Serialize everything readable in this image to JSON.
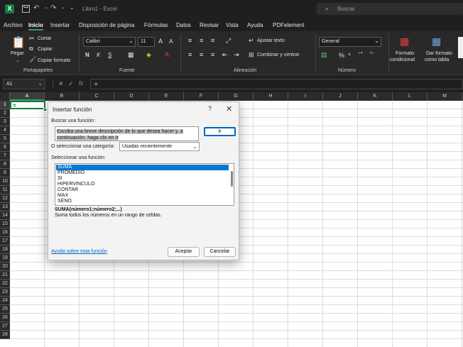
{
  "window": {
    "title": "Libro1 - Excel",
    "search_placeholder": "Buscar"
  },
  "menu": {
    "items": [
      "Archivo",
      "Inicio",
      "Insertar",
      "Disposición de página",
      "Fórmulas",
      "Datos",
      "Revisar",
      "Vista",
      "Ayuda",
      "PDFelement"
    ],
    "active": "Inicio"
  },
  "ribbon": {
    "clipboard": {
      "paste": "Pegar",
      "cut": "Cortar",
      "copy": "Copiar",
      "format_painter": "Copiar formato",
      "group": "Portapapeles"
    },
    "font": {
      "family": "Calibri",
      "size": "11",
      "grow": "A",
      "shrink": "A",
      "bold": "N",
      "italic": "K",
      "underline": "S",
      "group": "Fuente"
    },
    "alignment": {
      "wrap": "Ajustar texto",
      "merge": "Combinar y centrar",
      "group": "Alineación"
    },
    "number": {
      "format": "General",
      "percent": "%",
      "group": "Número"
    },
    "styles": {
      "conditional_line1": "Formato",
      "conditional_line2": "condicional",
      "table_line1": "Dar formato",
      "table_line2": "como tabla"
    }
  },
  "formula_bar": {
    "name_box": "A1",
    "fx": "fx",
    "value": "="
  },
  "grid": {
    "columns": [
      "A",
      "B",
      "C",
      "D",
      "E",
      "F",
      "G",
      "H",
      "I",
      "J",
      "K",
      "L",
      "M"
    ],
    "rows": [
      "1",
      "2",
      "3",
      "4",
      "5",
      "6",
      "7",
      "8",
      "9",
      "10",
      "11",
      "12",
      "13",
      "14",
      "15",
      "16",
      "17",
      "18",
      "19",
      "20",
      "21",
      "22",
      "23",
      "24",
      "25",
      "26",
      "27",
      "28"
    ],
    "active_cell_value": "="
  },
  "dialog": {
    "title": "Insertar función",
    "help": "?",
    "close": "✕",
    "search_label": "Buscar una función:",
    "search_text_line1": "Escriba una breve descripción de lo que desea hacer y, a",
    "search_text_line2": "continuación, haga clic en Ir",
    "go_button": "Ir",
    "category_label": "O seleccionar una categoría:",
    "category_value": "Usadas recientemente",
    "function_label": "Seleccionar una función:",
    "functions": [
      "SUMA",
      "PROMEDIO",
      "SI",
      "HIPERVINCULO",
      "CONTAR",
      "MAX",
      "SENO"
    ],
    "selected_function": "SUMA",
    "syntax": "SUMA(número1;número2;...)",
    "description": "Suma todos los números en un rango de celdas.",
    "help_link": "Ayuda sobre esta función",
    "accept": "Aceptar",
    "cancel": "Cancelar"
  },
  "colors": {
    "accent": "#107c41",
    "selection": "#0078d4",
    "link": "#0067c0"
  }
}
